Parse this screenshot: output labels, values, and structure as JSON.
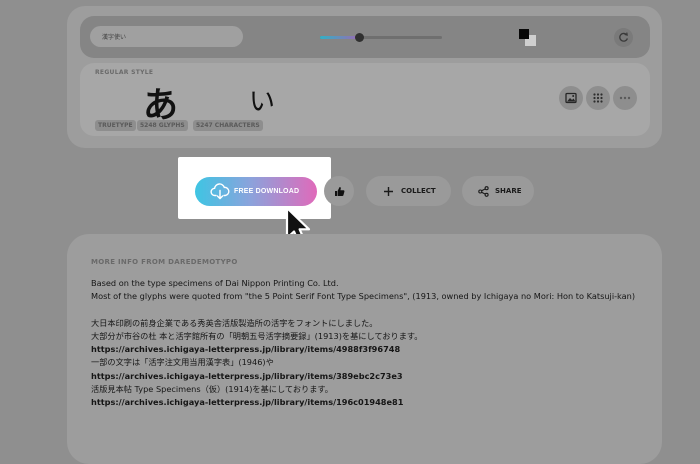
{
  "toolbar": {
    "sample_text": "漢字使い",
    "size_slider_level": 0.32
  },
  "preview": {
    "style_label": "REGULAR STYLE",
    "glyph_1": "あ",
    "glyph_2": "い",
    "badges": [
      "TRUETYPE",
      "5248 GLYPHS",
      "5247 CHARACTERS"
    ],
    "actions": [
      "image-icon",
      "grid-icon",
      "more-icon"
    ]
  },
  "actions": {
    "download_label": "FREE DOWNLOAD",
    "collect_label": "COLLECT",
    "share_label": "SHARE"
  },
  "info": {
    "title": "MORE INFO FROM DAREDEMOTYPO",
    "lines": [
      "Based on the type specimens of Dai Nippon Printing Co. Ltd.",
      "Most of the glyphs were quoted from \"the 5 Point Serif Font Type Specimens\", (1913, owned by Ichigaya no Mori: Hon to Katsuji-kan)",
      "大日本印刷の前身企業である秀英舎活版製造所の活字をフォントにしました。",
      "大部分が市谷の杜 本と活字館所有の「明朝五号活字摘要録」(1913)を基にしております。",
      "https://archives.ichigaya-letterpress.jp/library/items/4988f3f96748",
      "一部の文字は「活字注文用当用漢字表」(1946)や",
      "https://archives.ichigaya-letterpress.jp/library/items/389ebc2c73e3",
      "活版見本帖 Type Specimens（仮）(1914)を基にしております。",
      "https://archives.ichigaya-letterpress.jp/library/items/196c01948e81"
    ]
  },
  "colors": {
    "overlay": "#8f8f8f",
    "highlight": "#ffffff",
    "download_gradient_start": "#3ec5e3",
    "download_gradient_end": "#e06aba"
  }
}
